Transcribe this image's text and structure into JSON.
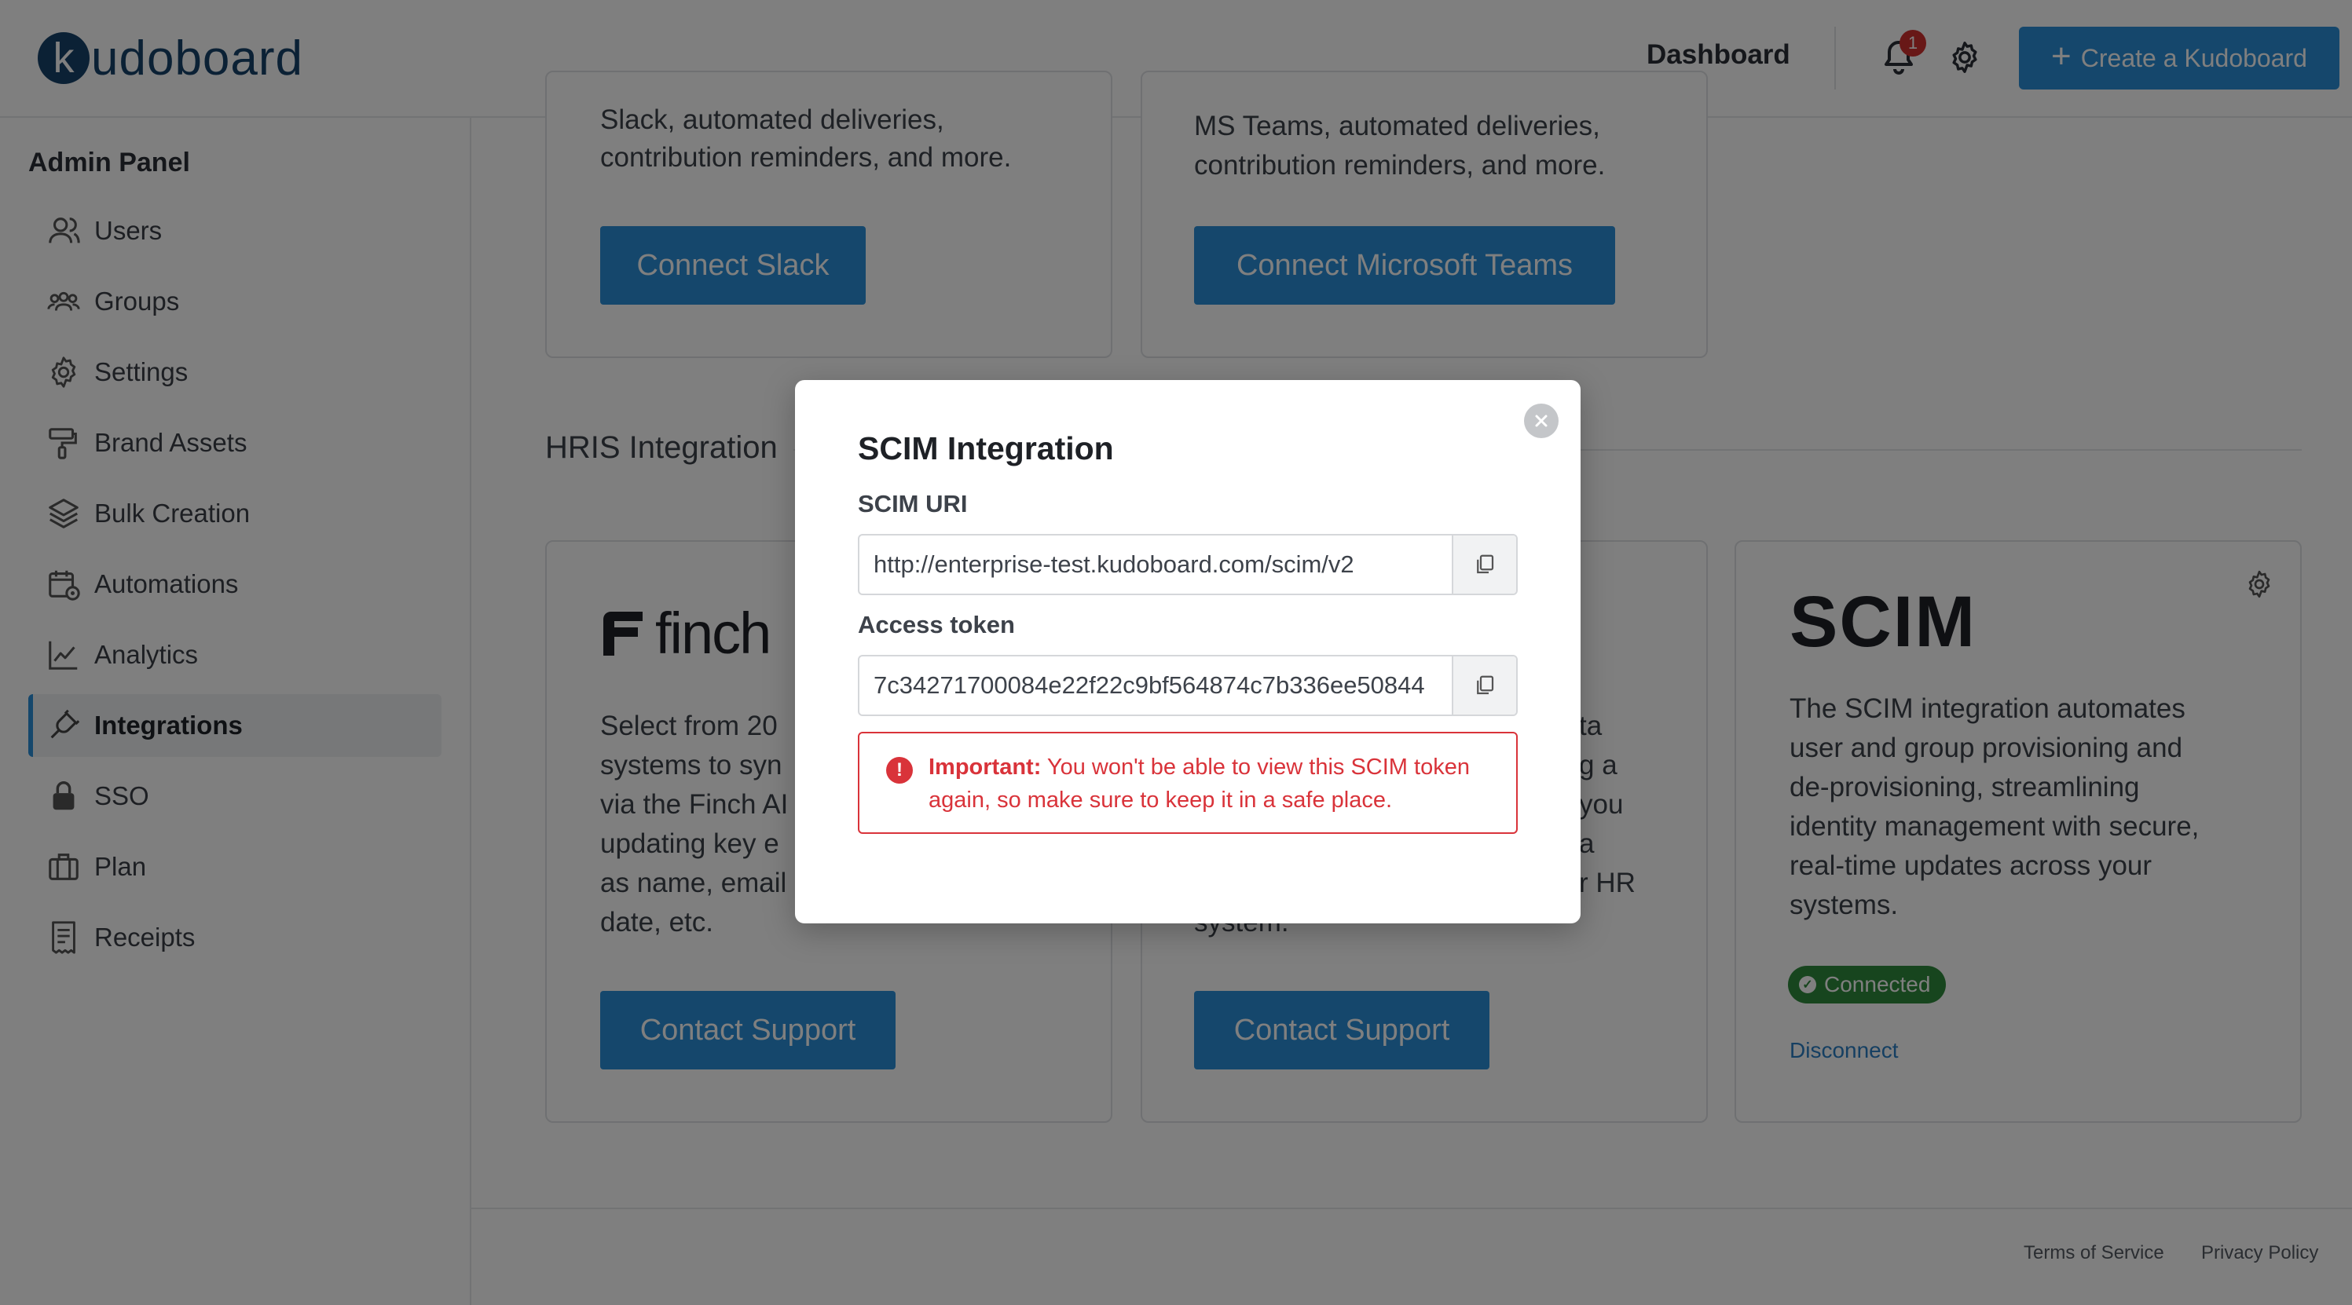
{
  "header": {
    "logo_letter": "k",
    "logo_rest": "udoboard",
    "dashboard_label": "Dashboard",
    "notification_count": "1",
    "create_label": "Create a Kudoboard"
  },
  "sidebar": {
    "title": "Admin Panel",
    "items": [
      {
        "label": "Users",
        "icon": "users-icon"
      },
      {
        "label": "Groups",
        "icon": "groups-icon"
      },
      {
        "label": "Settings",
        "icon": "gear-icon"
      },
      {
        "label": "Brand Assets",
        "icon": "paint-roller-icon"
      },
      {
        "label": "Bulk Creation",
        "icon": "layers-icon"
      },
      {
        "label": "Automations",
        "icon": "calendar-gear-icon"
      },
      {
        "label": "Analytics",
        "icon": "chart-line-icon"
      },
      {
        "label": "Integrations",
        "icon": "plug-icon",
        "active": true
      },
      {
        "label": "SSO",
        "icon": "lock-icon"
      },
      {
        "label": "Plan",
        "icon": "briefcase-icon"
      },
      {
        "label": "Receipts",
        "icon": "receipt-icon"
      }
    ]
  },
  "main": {
    "slack_card": {
      "text_line1": "Slack, automated deliveries,",
      "text_line2": "contribution reminders, and more.",
      "button": "Connect Slack"
    },
    "teams_card": {
      "text_line1": "MS Teams, automated deliveries,",
      "text_line2": "contribution reminders, and more.",
      "button": "Connect Microsoft Teams"
    },
    "section_title": "HRIS Integration",
    "finch_card": {
      "logo_text": "finch",
      "lines": [
        "Select from 20",
        "systems to syn",
        "via the Finch AI",
        "updating key e",
        "as name, email",
        "date, etc."
      ],
      "button": "Contact Support"
    },
    "middle_card": {
      "lines": [
        "ta",
        "g a",
        "you",
        "a",
        "r HR",
        "system."
      ],
      "button": "Contact Support"
    },
    "scim_card": {
      "logo_text": "SCIM",
      "lines": [
        "The SCIM integration automates",
        "user and group provisioning and",
        "de-provisioning, streamlining",
        "identity management with secure,",
        "real-time updates across your",
        "systems."
      ],
      "status": "Connected",
      "disconnect": "Disconnect"
    }
  },
  "footer": {
    "terms": "Terms of Service",
    "privacy": "Privacy Policy"
  },
  "modal": {
    "title": "SCIM Integration",
    "uri_label": "SCIM URI",
    "uri_value": "http://enterprise-test.kudoboard.com/scim/v2",
    "token_label": "Access token",
    "token_value": "7c34271700084e22f22c9bf564874c7b336ee50844",
    "alert_strong": "Important:",
    "alert_text": " You won't be able to view this SCIM token again, so make sure to keep it in a safe place."
  },
  "colors": {
    "accent": "#2a8fd8",
    "brand": "#16426a",
    "danger": "#d9333a",
    "success": "#2f8a3c"
  }
}
